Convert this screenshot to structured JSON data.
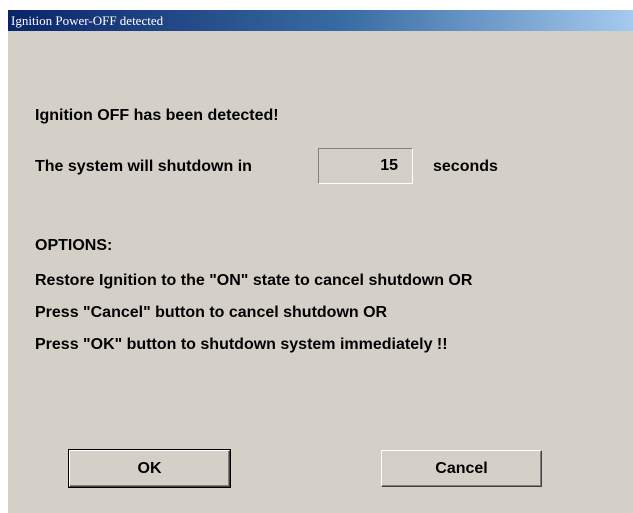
{
  "window": {
    "title": "Ignition Power-OFF detected"
  },
  "message": {
    "headline": "Ignition OFF has been detected!",
    "shutdown_prefix": "The system will shutdown in",
    "countdown_value": "15",
    "shutdown_suffix": "seconds"
  },
  "options": {
    "heading": "OPTIONS:",
    "lines": [
      "Restore Ignition to the \"ON\" state to cancel shutdown OR",
      "Press \"Cancel\" button to cancel shutdown OR",
      "Press \"OK\" button to shutdown system immediately !!"
    ]
  },
  "buttons": {
    "ok_label": "OK",
    "cancel_label": "Cancel"
  },
  "colors": {
    "dialog_background": "#d4d0c8",
    "titlebar_start": "#0a246a",
    "titlebar_end": "#a6caf0"
  }
}
